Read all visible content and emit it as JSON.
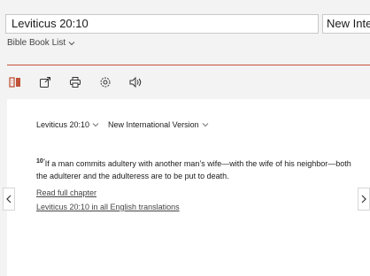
{
  "search": {
    "value": "Leviticus 20:10"
  },
  "version": {
    "value": "New International Version"
  },
  "book_list": {
    "label": "Bible Book List"
  },
  "toolbar": {
    "icons": [
      "parallel-view-icon",
      "share-icon",
      "print-icon",
      "settings-icon",
      "audio-icon"
    ],
    "accent_color": "#c0533a"
  },
  "passage": {
    "reference": "Leviticus 20:10",
    "version": "New International Version",
    "verse_number": "10",
    "quote_mark": "“",
    "text": "If a man commits adultery with another man’s wife—with the wife of his neighbor—both the adulterer and the adulteress are to be put to death."
  },
  "links": {
    "read_full": "Read full chapter",
    "all_translations": "Leviticus 20:10 in all English translations"
  },
  "nav": {
    "prev": "‹",
    "next": "›"
  }
}
